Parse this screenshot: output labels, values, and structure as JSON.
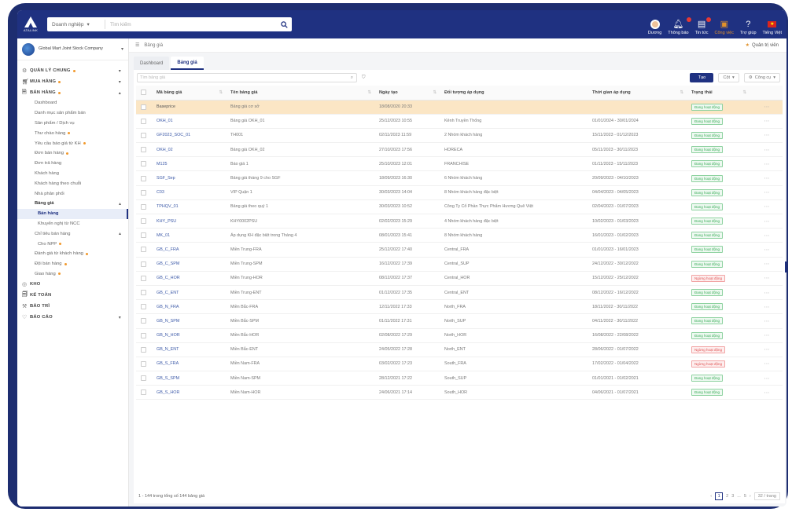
{
  "app": {
    "logo_text": "ATALINK",
    "search_scope": "Doanh nghiệp",
    "search_placeholder": "Tìm kiếm"
  },
  "top_actions": [
    {
      "label": "Dương",
      "icon": "user-avatar-icon",
      "active": false
    },
    {
      "label": "Thông báo",
      "icon": "bell-icon",
      "active": false
    },
    {
      "label": "Tin tức",
      "icon": "news-icon",
      "active": false
    },
    {
      "label": "Công việc",
      "icon": "briefcase-icon",
      "active": true
    },
    {
      "label": "Trợ giúp",
      "icon": "help-icon",
      "active": false
    },
    {
      "label": "Tiếng Việt",
      "icon": "flag-icon",
      "active": false
    }
  ],
  "company": {
    "name": "Global Mart Joint Stock Company"
  },
  "sidebar": {
    "items": [
      {
        "label": "QUẢN LÝ CHUNG",
        "level": "top",
        "dot": true,
        "chev": "▾"
      },
      {
        "label": "MUA HÀNG",
        "level": "top",
        "dot": true,
        "chev": "▾"
      },
      {
        "label": "BÁN HÀNG",
        "level": "top",
        "dot": true,
        "chev": "▴"
      },
      {
        "label": "Dashboard",
        "level": "sub"
      },
      {
        "label": "Danh mục sản phẩm bán",
        "level": "sub"
      },
      {
        "label": "Sản phẩm / Dịch vụ",
        "level": "sub"
      },
      {
        "label": "Thư chào hàng",
        "level": "sub",
        "dot": true
      },
      {
        "label": "Yêu cầu báo giá từ KH",
        "level": "sub",
        "dot": true
      },
      {
        "label": "Đơn bán hàng",
        "level": "sub",
        "dot": true
      },
      {
        "label": "Đơn trả hàng",
        "level": "sub"
      },
      {
        "label": "Khách hàng",
        "level": "sub"
      },
      {
        "label": "Khách hàng theo chuỗi",
        "level": "sub"
      },
      {
        "label": "Nhà phân phối",
        "level": "sub"
      },
      {
        "label": "Bảng giá",
        "level": "group",
        "chev": "▴"
      },
      {
        "label": "Bán hàng",
        "level": "sub2",
        "selected": true
      },
      {
        "label": "Khuyến nghị từ NCC",
        "level": "sub2"
      },
      {
        "label": "Chỉ tiêu bán hàng",
        "level": "sub",
        "chev": "▴"
      },
      {
        "label": "Cho NPP",
        "level": "sub2",
        "dot": true
      },
      {
        "label": "Đánh giá từ khách hàng",
        "level": "sub",
        "dot": true
      },
      {
        "label": "Đội bán hàng",
        "level": "sub",
        "dot": true
      },
      {
        "label": "Giao hàng",
        "level": "sub",
        "dot": true
      },
      {
        "label": "KHO",
        "level": "top"
      },
      {
        "label": "KẾ TOÁN",
        "level": "top"
      },
      {
        "label": "BẢO TRÌ",
        "level": "top"
      },
      {
        "label": "BÁO CÁO",
        "level": "top",
        "chev": "▾"
      }
    ]
  },
  "breadcrumb": {
    "label": "Bảng giá",
    "right": "Quản trị viên"
  },
  "tabs": [
    "Dashboard",
    "Bảng giá"
  ],
  "toolbar": {
    "filter_placeholder": "Tìm bảng giá",
    "create": "Tạo",
    "columns": "Cột",
    "tools": "Công cụ"
  },
  "table": {
    "headers": [
      "Mã bảng giá",
      "Tên bảng giá",
      "Ngày tạo",
      "Đối tượng áp dụng",
      "Thời gian áp dụng",
      "Trạng thái"
    ],
    "rows": [
      [
        "Baseprice",
        "Bảng giá cơ sở",
        "18/08/2020 20:33",
        "",
        "",
        "on"
      ],
      [
        "OKH_01",
        "Bảng giá OKH_01",
        "25/12/2023 10:55",
        "Kênh Truyền Thống",
        "01/01/2024 - 30/01/2024",
        "on"
      ],
      [
        "GF2023_SOC_01",
        "TH001",
        "02/11/2023 11:59",
        "2 Nhóm khách hàng",
        "15/11/2023 - 01/12/2023",
        "on"
      ],
      [
        "OKH_02",
        "Bảng giá OKH_02",
        "27/10/2023 17:56",
        "HORECA",
        "05/11/2023 - 30/11/2023",
        "on"
      ],
      [
        "M125",
        "Báo giá 1",
        "25/10/2023 12:01",
        "FRANCHISE",
        "01/11/2023 - 15/11/2023",
        "on"
      ],
      [
        "SGF_Sep",
        "Bảng giá tháng 9 cho SGF",
        "18/09/2023 16:30",
        "6 Nhóm khách hàng",
        "20/09/2023 - 04/10/2023",
        "on"
      ],
      [
        "C03",
        "VIP Quận 1",
        "30/03/2023 14:04",
        "8 Nhóm khách hàng đặc biệt",
        "04/04/2023 - 04/05/2023",
        "on"
      ],
      [
        "TPHQV_01",
        "Bảng giá theo quý 1",
        "30/03/2023 10:52",
        "Công Ty Cổ Phần Thực Phẩm Hương Quê Việt",
        "02/04/2023 - 01/07/2023",
        "on"
      ],
      [
        "KHY_PSU",
        "KHY0002PSU",
        "02/02/2023 15:29",
        "4 Nhóm khách hàng đặc biệt",
        "10/02/2023 - 01/03/2023",
        "on"
      ],
      [
        "MK_01",
        "Áp dụng KH đặc biệt trong Tháng 4",
        "08/01/2023 15:41",
        "8 Nhóm khách hàng",
        "16/01/2023 - 01/02/2023",
        "on"
      ],
      [
        "GB_C_FRA",
        "Miền Trung-FRA",
        "25/12/2022 17:40",
        "Central_FRA",
        "01/01/2023 - 16/01/2023",
        "on"
      ],
      [
        "GB_C_SPM",
        "Miền Trung-SPM",
        "16/12/2022 17:39",
        "Central_SUP",
        "24/12/2022 - 30/12/2022",
        "on"
      ],
      [
        "GB_C_HOR",
        "Miền Trung-HOR",
        "08/12/2022 17:37",
        "Central_HOR",
        "15/12/2022 - 25/12/2022",
        "off"
      ],
      [
        "GB_C_ENT",
        "Miền Trung-ENT",
        "01/12/2022 17:35",
        "Central_ENT",
        "08/12/2022 - 16/12/2022",
        "on"
      ],
      [
        "GB_N_FRA",
        "Miền Bắc-FRA",
        "12/11/2022 17:33",
        "North_FRA",
        "18/11/2022 - 30/11/2022",
        "on"
      ],
      [
        "GB_N_SPM",
        "Miền Bắc-SPM",
        "01/11/2022 17:31",
        "North_SUP",
        "04/11/2022 - 30/11/2022",
        "on"
      ],
      [
        "GB_N_HOR",
        "Miền Bắc-HOR",
        "02/08/2022 17:29",
        "North_HOR",
        "16/08/2022 - 22/08/2022",
        "on"
      ],
      [
        "GB_N_ENT",
        "Miền Bắc-ENT",
        "24/05/2022 17:28",
        "North_ENT",
        "28/06/2022 - 01/07/2022",
        "off"
      ],
      [
        "GB_S_FRA",
        "Miền Nam-FRA",
        "03/02/2022 17:23",
        "South_FRA",
        "17/02/2022 - 01/04/2022",
        "off"
      ],
      [
        "GB_S_SPM",
        "Miền Nam-SPM",
        "28/12/2021 17:22",
        "South_SUP",
        "01/01/2021 - 01/02/2021",
        "on"
      ],
      [
        "GB_S_HOR",
        "Miền Nam-HOR",
        "24/06/2021 17:14",
        "South_HOR",
        "04/06/2021 - 01/07/2021",
        "on"
      ]
    ],
    "status_labels": {
      "on": "Đang hoạt động",
      "off": "Ngừng hoạt động"
    }
  },
  "footer": {
    "summary": "1 - 144 trong tổng số 144 bảng giá",
    "pages": [
      "1",
      "2",
      "3",
      "...",
      "5"
    ],
    "page_size": "32 / trang"
  },
  "colors": {
    "brand": "#1f3181",
    "accent": "#e0912b",
    "active_status": "#3cae5b",
    "inactive_status": "#e05252",
    "highlight_row": "#fbe6c5"
  }
}
